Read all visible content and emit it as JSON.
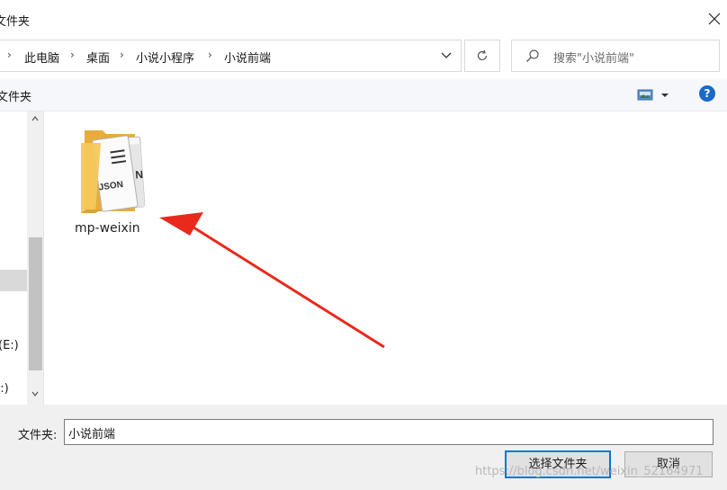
{
  "window": {
    "title": "文件夹"
  },
  "address": {
    "crumbs": [
      "此电脑",
      "桌面",
      "小说小程序",
      "小说前端"
    ],
    "separator": "›"
  },
  "search": {
    "placeholder": "搜索\"小说前端\""
  },
  "toolbar": {
    "new_folder": "文件夹",
    "help": "?"
  },
  "nav": {
    "drive1": "(E:)",
    "drive2": "S:)"
  },
  "content": {
    "items": [
      {
        "label": "mp-weixin",
        "icon_text": "JSON"
      }
    ]
  },
  "bottom": {
    "filename_label": "文件夹:",
    "filename_value": "小说前端",
    "ok_label": "选择文件夹",
    "cancel_label": "取消",
    "watermark": "https://blog.csdn.net/weixin_52164971"
  },
  "colors": {
    "accent": "#0078d7",
    "help_bg": "#1b6ac9",
    "annotation_arrow": "#e8291c",
    "folder": "#f3c85c"
  }
}
